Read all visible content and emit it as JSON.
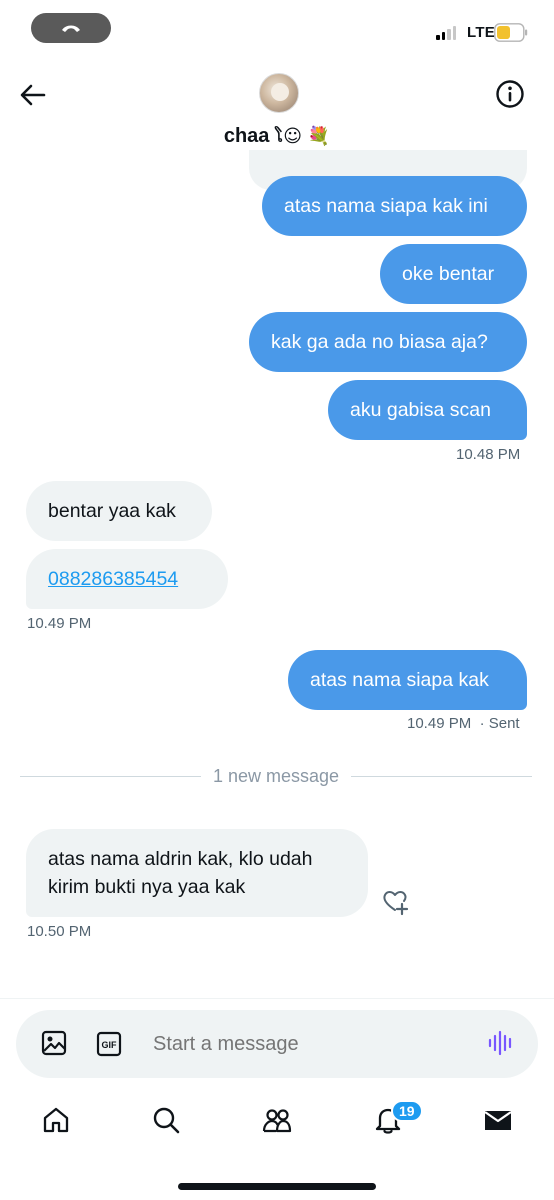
{
  "status_bar": {
    "network": "LTE",
    "battery_color": "#f2c12e"
  },
  "header": {
    "name": "chaa",
    "name_emoji": "ໂ☺︎ 💐",
    "avatar_icon": "avatar-photo"
  },
  "messages": {
    "m1": "atas nama siapa kak ini",
    "m2": "oke bentar",
    "m3": "kak ga ada no biasa aja?",
    "m4": "aku gabisa scan",
    "ts1": "10.48 PM",
    "m5": "bentar yaa kak",
    "m6": "088286385454",
    "ts2": "10.49 PM",
    "m7": "atas nama siapa kak",
    "ts3": "10.49 PM",
    "sent_label": "· Sent",
    "new_divider": "1 new message",
    "m8": "atas nama aldrin kak, klo udah kirim bukti nya yaa kak",
    "ts4": "10.50 PM"
  },
  "composer": {
    "placeholder": "Start a message"
  },
  "nav": {
    "notifications_badge": "19"
  },
  "colors": {
    "outgoing_bubble": "#4a99e9",
    "incoming_bubble": "#eff3f4",
    "accent": "#1d9bf0",
    "voice": "#7856ff"
  }
}
